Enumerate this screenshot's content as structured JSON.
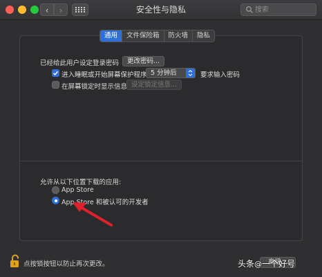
{
  "window": {
    "title": "安全性与隐私",
    "search_placeholder": "搜索"
  },
  "tabs": [
    {
      "label": "通用",
      "active": true
    },
    {
      "label": "文件保险箱",
      "active": false
    },
    {
      "label": "防火墙",
      "active": false
    },
    {
      "label": "隐私",
      "active": false
    }
  ],
  "general": {
    "login_password_label": "已经给此用户设定登录密码",
    "change_password_button": "更改密码...",
    "require_password": {
      "checked": true,
      "label": "进入睡眠或开始屏幕保护程序",
      "delay_value": "5 分钟后",
      "suffix": "要求输入密码"
    },
    "show_message": {
      "checked": false,
      "label": "在屏幕锁定时显示信息",
      "button": "设定锁定信息..."
    },
    "download_heading": "允许从以下位置下载的应用:",
    "download_options": [
      {
        "label": "App Store",
        "selected": false
      },
      {
        "label": "App Store 和被认可的开发者",
        "selected": true
      }
    ]
  },
  "footer": {
    "lock_text": "点按锁按钮以防止再次更改。",
    "advanced_button": "高级..."
  },
  "watermark": {
    "text": "头条",
    "at": "@",
    "handle": "一个好号"
  },
  "colors": {
    "accent": "#2e6fd8",
    "annotation_arrow": "#e0202a",
    "lock_icon": "#e0a21a"
  }
}
